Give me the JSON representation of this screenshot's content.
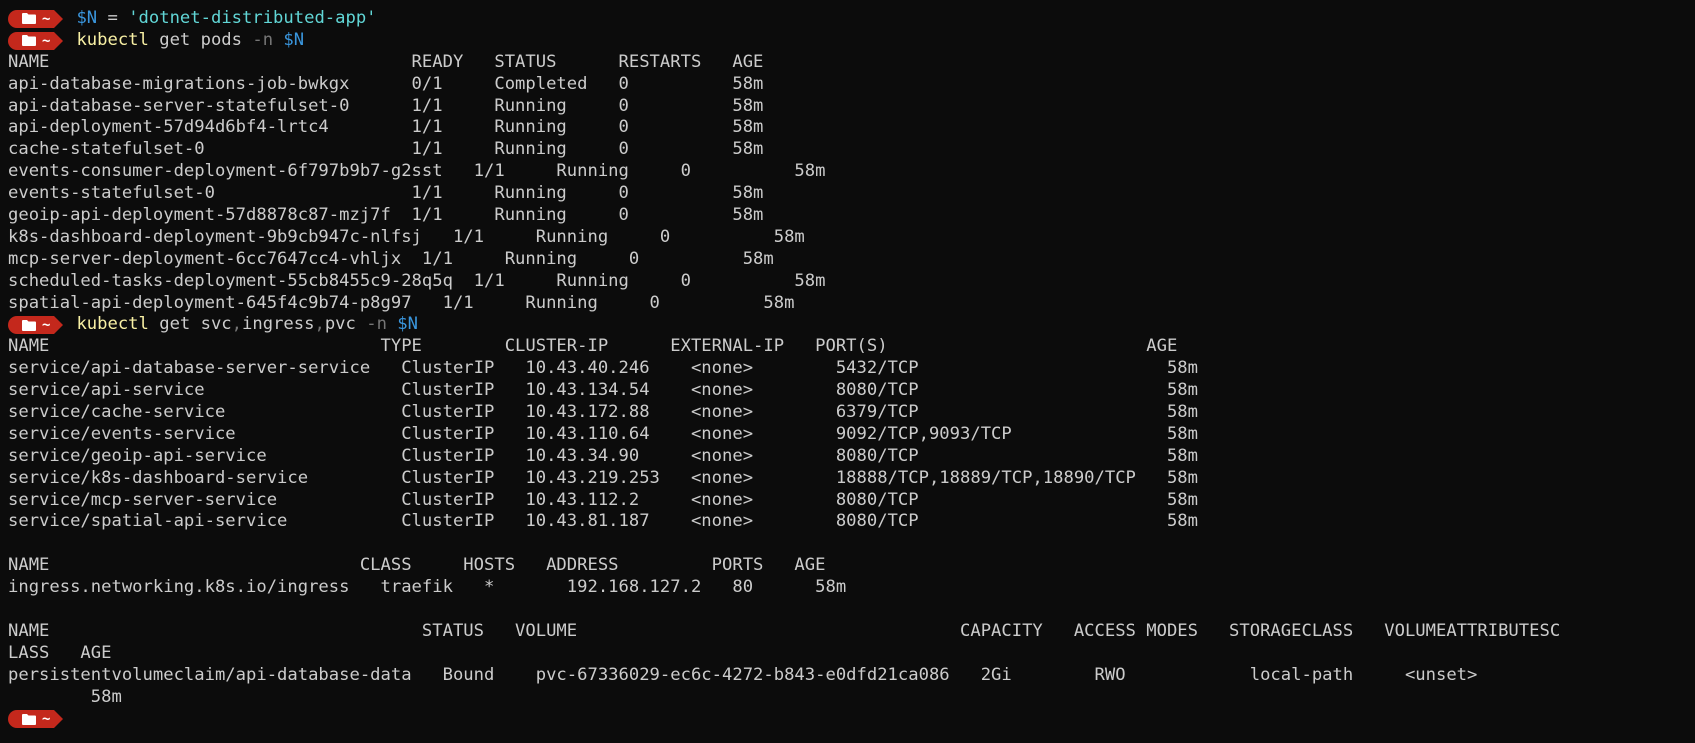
{
  "prompt": {
    "tilde": "~"
  },
  "cmd1": {
    "var": "$N",
    "op": " = ",
    "value": "'dotnet-distributed-app'"
  },
  "cmd2": {
    "cmd": "kubectl",
    "args": " get pods ",
    "flag": "-n",
    "var": "$N"
  },
  "pods": {
    "header": "NAME                                   READY   STATUS      RESTARTS   AGE",
    "rows": [
      "api-database-migrations-job-bwkgx      0/1     Completed   0          58m",
      "api-database-server-statefulset-0      1/1     Running     0          58m",
      "api-deployment-57d94d6bf4-lrtc4        1/1     Running     0          58m",
      "cache-statefulset-0                    1/1     Running     0          58m",
      "events-consumer-deployment-6f797b9b7-g2sst   1/1     Running     0          58m",
      "events-statefulset-0                   1/1     Running     0          58m",
      "geoip-api-deployment-57d8878c87-mzj7f  1/1     Running     0          58m",
      "k8s-dashboard-deployment-9b9cb947c-nlfsj   1/1     Running     0          58m",
      "mcp-server-deployment-6cc7647cc4-vhljx  1/1     Running     0          58m",
      "scheduled-tasks-deployment-55cb8455c9-28q5q  1/1     Running     0          58m",
      "spatial-api-deployment-645f4c9b74-p8g97   1/1     Running     0          58m"
    ]
  },
  "cmd3": {
    "cmd": "kubectl",
    "args1": " get svc",
    "sep1": ",",
    "args2": "ingress",
    "sep2": ",",
    "args3": "pvc ",
    "flag": "-n",
    "var": "$N"
  },
  "services": {
    "header": "NAME                                TYPE        CLUSTER-IP      EXTERNAL-IP   PORT(S)                         AGE",
    "rows": [
      "service/api-database-server-service   ClusterIP   10.43.40.246    <none>        5432/TCP                        58m",
      "service/api-service                   ClusterIP   10.43.134.54    <none>        8080/TCP                        58m",
      "service/cache-service                 ClusterIP   10.43.172.88    <none>        6379/TCP                        58m",
      "service/events-service                ClusterIP   10.43.110.64    <none>        9092/TCP,9093/TCP               58m",
      "service/geoip-api-service             ClusterIP   10.43.34.90     <none>        8080/TCP                        58m",
      "service/k8s-dashboard-service         ClusterIP   10.43.219.253   <none>        18888/TCP,18889/TCP,18890/TCP   58m",
      "service/mcp-server-service            ClusterIP   10.43.112.2     <none>        8080/TCP                        58m",
      "service/spatial-api-service           ClusterIP   10.43.81.187    <none>        8080/TCP                        58m"
    ]
  },
  "ingress": {
    "header": "NAME                              CLASS     HOSTS   ADDRESS         PORTS   AGE",
    "row": "ingress.networking.k8s.io/ingress   traefik   *       192.168.127.2   80      58m"
  },
  "pvc": {
    "header1": "NAME                                    STATUS   VOLUME                                     CAPACITY   ACCESS MODES   STORAGECLASS   VOLUMEATTRIBUTESC",
    "header2": "LASS   AGE",
    "row1": "persistentvolumeclaim/api-database-data   Bound    pvc-67336029-ec6c-4272-b843-e0dfd21ca086   2Gi        RWO            local-path     <unset>",
    "row2": "        58m"
  },
  "colors": {
    "background": "#0c0c0c",
    "text": "#cccccc",
    "badge": "#c4281c",
    "command": "#f9f1a5",
    "variable": "#3a96dd",
    "string": "#61d6d6",
    "flag": "#767676"
  },
  "icons": {
    "prompt_folder": "folder-icon"
  }
}
